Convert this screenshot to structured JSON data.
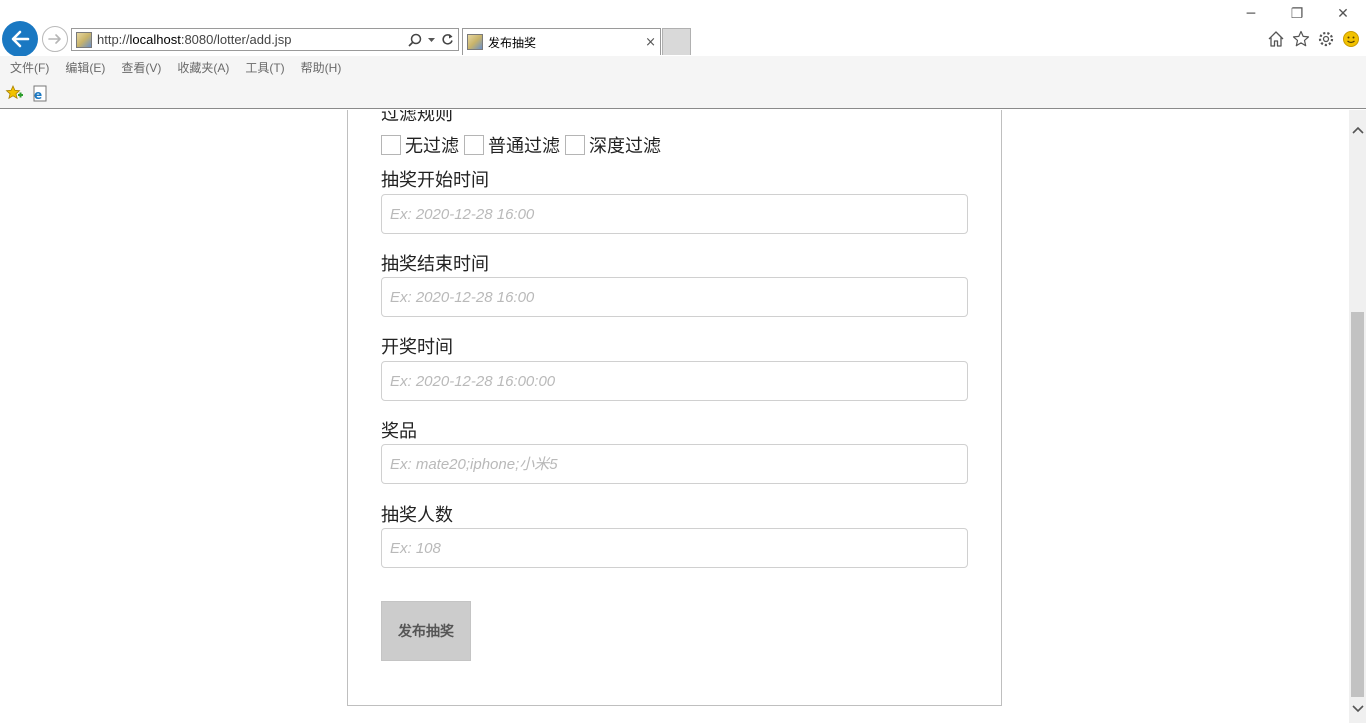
{
  "browser": {
    "url_prefix": "http://",
    "url_host": "localhost",
    "url_rest": ":8080/lotter/add.jsp",
    "tab_title": "发布抽奖",
    "tab_close": "×",
    "menu": [
      "文件(F)",
      "编辑(E)",
      "查看(V)",
      "收藏夹(A)",
      "工具(T)",
      "帮助(H)"
    ],
    "window_controls": [
      "─",
      "❐",
      "✕"
    ]
  },
  "form": {
    "filter_label": "过滤规则",
    "filter_options": [
      "无过滤",
      "普通过滤",
      "深度过滤"
    ],
    "start_time_label": "抽奖开始时间",
    "start_time_placeholder": "Ex: 2020-12-28 16:00",
    "end_time_label": "抽奖结束时间",
    "end_time_placeholder": "Ex: 2020-12-28 16:00",
    "draw_time_label": "开奖时间",
    "draw_time_placeholder": "Ex: 2020-12-28 16:00:00",
    "prize_label": "奖品",
    "prize_placeholder": "Ex: mate20;iphone;小米5",
    "winners_label": "抽奖人数",
    "winners_placeholder": "Ex: 108",
    "submit_label": "发布抽奖"
  },
  "colors": {
    "back_button": "#1a78c2",
    "submit_bg": "#cccccc",
    "scroll_thumb": "#c2c2c2"
  },
  "scroll": {
    "thumb_fraction": 0.63,
    "position_fraction": 0.35
  }
}
